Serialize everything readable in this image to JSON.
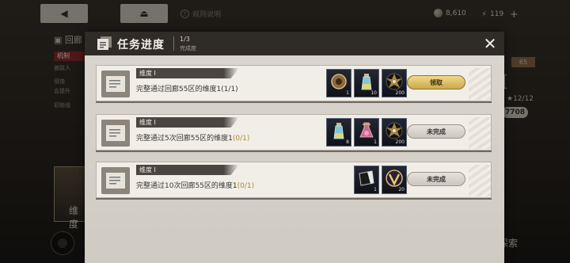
{
  "background": {
    "help_label": "规则说明",
    "coins": "8,610",
    "energy": "119",
    "left_title": "回廊",
    "left_tag": "机制",
    "left_lines": [
      "被敌人",
      "侵蚀",
      "会提升",
      "初始侵"
    ],
    "level_badge": "65",
    "roman": "I",
    "stars": "★12/12",
    "number_badge": "7708",
    "card_label": "维度",
    "search_label": "探索"
  },
  "dialog": {
    "title": "任务进度",
    "count": "1/3",
    "count_label": "完成度",
    "tasks": [
      {
        "name": "维度 I",
        "desc": "完整通过回廊55区的维度1",
        "progress": "(1/1)",
        "button": "领取",
        "status": "claim",
        "rewards": [
          {
            "icon": "bronze-disc-icon",
            "qty": "1"
          },
          {
            "icon": "potion-bottle-icon",
            "qty": "10"
          },
          {
            "icon": "vinyl-record-icon",
            "qty": "200"
          }
        ]
      },
      {
        "name": "维度 I",
        "desc": "完整通过5次回廊55区的维度1",
        "progress": "(0/1)",
        "button": "未完成",
        "status": "pending",
        "rewards": [
          {
            "icon": "potion-bottle-icon",
            "qty": "8"
          },
          {
            "icon": "pink-flask-icon",
            "qty": "1"
          },
          {
            "icon": "vinyl-record-icon",
            "qty": "200"
          }
        ]
      },
      {
        "name": "维度 I",
        "desc": "完整通过10次回廊55区的维度1",
        "progress": "(0/1)",
        "button": "未完成",
        "status": "pending",
        "rewards": [
          {
            "icon": "black-card-icon",
            "qty": "1"
          },
          {
            "icon": "gold-emblem-icon",
            "qty": "20"
          }
        ]
      }
    ]
  },
  "colors": {
    "header": "#2f2b26",
    "claim_button": "#e8c970",
    "progress": "#b08a2e"
  }
}
